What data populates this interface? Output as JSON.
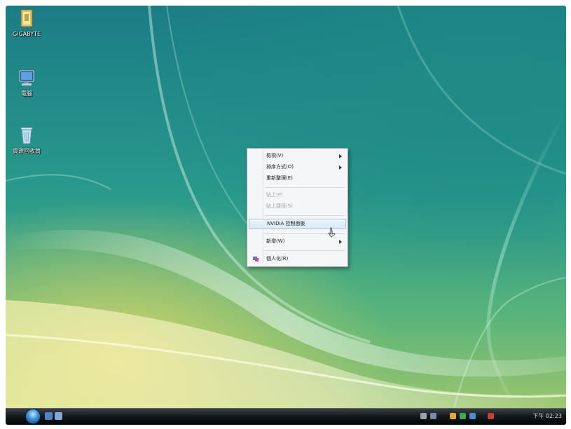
{
  "desktop": {
    "icons": [
      {
        "label": "GIGABYTE",
        "icon": "folder-icon"
      },
      {
        "label": "電腦",
        "icon": "computer-icon"
      },
      {
        "label": "資源回收筒",
        "icon": "recycle-bin-icon"
      }
    ]
  },
  "context_menu": {
    "items": [
      {
        "label": "檢視(V)",
        "has_submenu": true,
        "disabled": false
      },
      {
        "label": "排序方式(O)",
        "has_submenu": true,
        "disabled": false
      },
      {
        "label": "重新整理(E)",
        "has_submenu": false,
        "disabled": false
      },
      {
        "label": "貼上(P)",
        "has_submenu": false,
        "disabled": true
      },
      {
        "label": "貼上捷徑(S)",
        "has_submenu": false,
        "disabled": true
      },
      {
        "label": "NVIDIA 控制面板",
        "has_submenu": false,
        "disabled": false,
        "highlighted": true
      },
      {
        "label": "新增(W)",
        "has_submenu": true,
        "disabled": false
      },
      {
        "label": "個人化(R)",
        "has_submenu": false,
        "disabled": false,
        "icon": "personalize-icon"
      }
    ]
  },
  "taskbar": {
    "start_button": "start-orb-icon",
    "quick_launch": [
      "show-desktop-icon",
      "switch-windows-icon"
    ],
    "tray_icons": [
      "network-icon",
      "volume-icon",
      "security-icon",
      "update-icon",
      "power-icon"
    ],
    "clock": "下午 02:23"
  },
  "colors": {
    "menu_background": "#f4f6f8",
    "menu_highlight": "#d9e8f7",
    "taskbar": "#15191c"
  }
}
